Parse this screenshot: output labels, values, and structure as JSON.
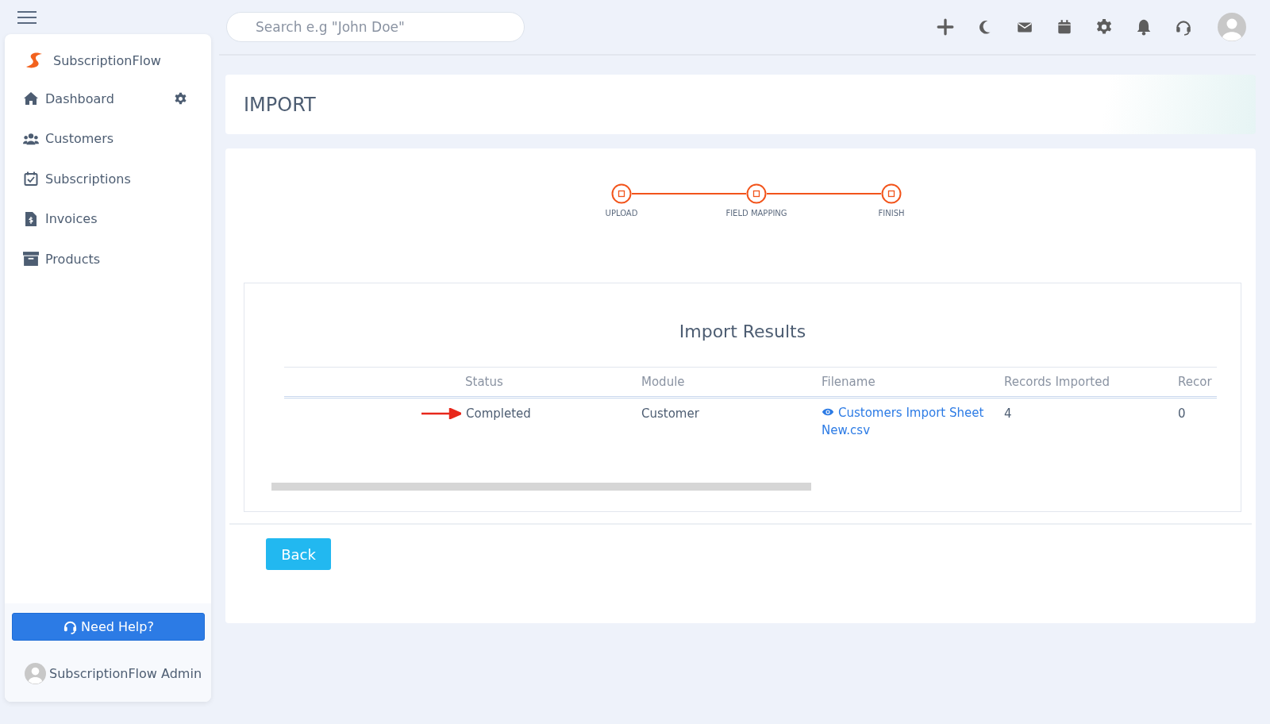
{
  "sidebar": {
    "brand": "SubscriptionFlow",
    "items": [
      {
        "label": "Dashboard",
        "kind": "home",
        "has_settings": true
      },
      {
        "label": "Customers",
        "kind": "users",
        "has_settings": false
      },
      {
        "label": "Subscriptions",
        "kind": "calendar",
        "has_settings": false
      },
      {
        "label": "Invoices",
        "kind": "invoice",
        "has_settings": false
      },
      {
        "label": "Products",
        "kind": "box",
        "has_settings": false
      }
    ],
    "help_button": "Need Help?",
    "user": "SubscriptionFlow Admin"
  },
  "topbar": {
    "search": {
      "placeholder": "Search e.g \"John Doe\""
    }
  },
  "page": {
    "title": "IMPORT",
    "steps": [
      {
        "label": "UPLOAD"
      },
      {
        "label": "FIELD MAPPING"
      },
      {
        "label": "FINISH"
      }
    ],
    "results": {
      "title": "Import Results",
      "columns": [
        "Status",
        "Module",
        "Filename",
        "Records Imported",
        "Recor"
      ],
      "rows": [
        {
          "status": "Completed",
          "module": "Customer",
          "filename": "Customers Import Sheet New.csv",
          "records_imported": "4",
          "column_5": "0"
        }
      ]
    },
    "back_button": "Back"
  }
}
